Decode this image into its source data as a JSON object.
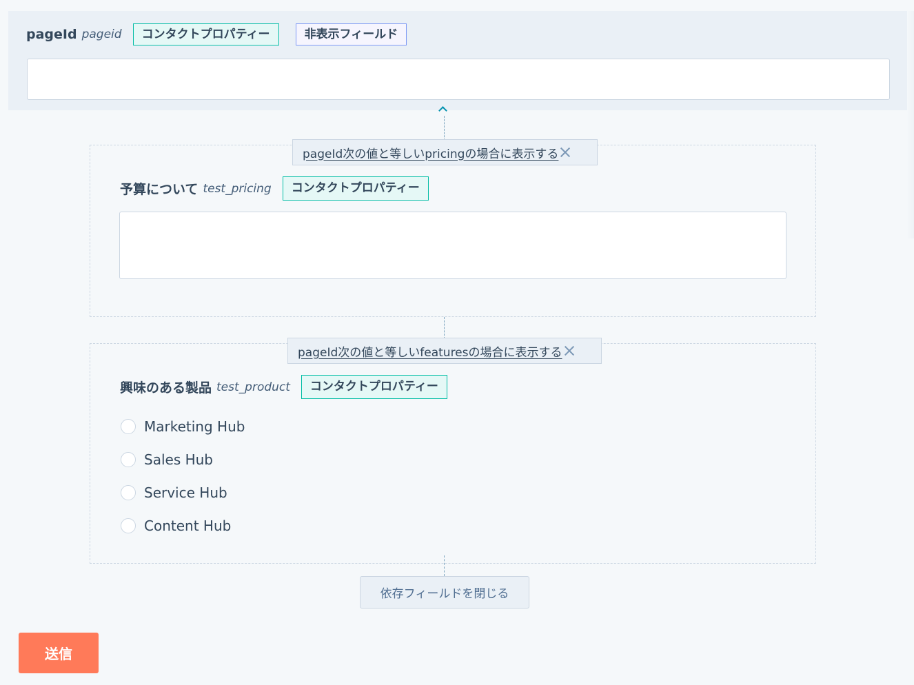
{
  "colors": {
    "background": "#f5f8fa",
    "text": "#33475b",
    "contact_tag_border": "#00bda5",
    "contact_tag_bg": "#e5f8f6",
    "hidden_tag_border": "#7c98f5",
    "submit": "#ff7a59",
    "link_line": "#0091ae"
  },
  "top_field": {
    "label": "pageId",
    "internal_name": "pageid",
    "tags": [
      "コンタクトプロパティー",
      "非表示フィールド"
    ],
    "value": ""
  },
  "pricing_field": {
    "rule": "pageId次の値と等しいpricingの場合に表示する",
    "label": "予算について",
    "internal_name": "test_pricing",
    "tag": "コンタクトプロパティー",
    "value": ""
  },
  "product_field": {
    "rule": "pageId次の値と等しいfeaturesの場合に表示する",
    "label": "興味のある製品",
    "internal_name": "test_product",
    "tag": "コンタクトプロパティー",
    "options": [
      "Marketing Hub",
      "Sales Hub",
      "Service Hub",
      "Content Hub"
    ]
  },
  "close_dependent_fields_label": "依存フィールドを閉じる",
  "submit_label": "送信",
  "icons": {
    "expand": "chevron-up-icon",
    "remove_rule": "close-icon"
  }
}
